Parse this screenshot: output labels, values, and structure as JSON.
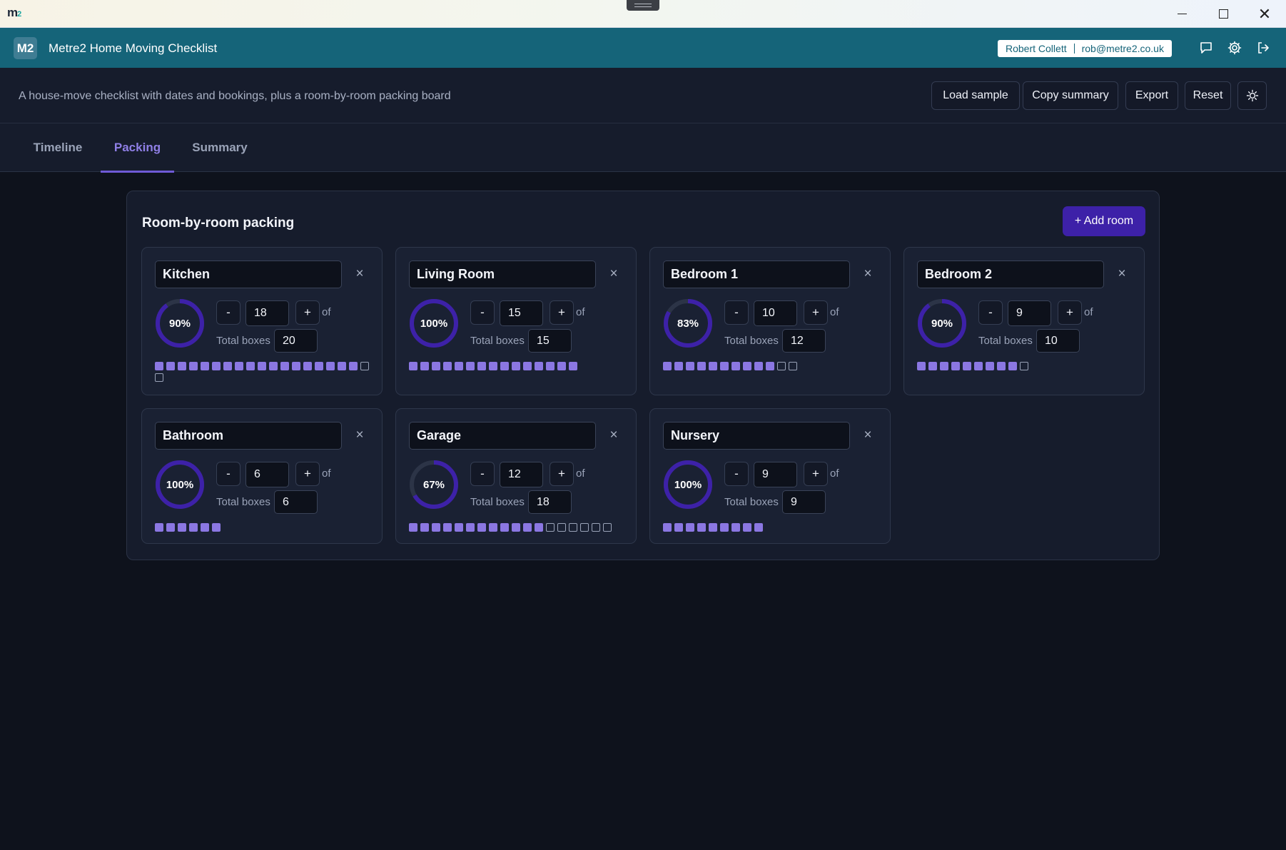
{
  "os": {
    "logo_main": "m",
    "logo_sub": "2",
    "icons": {
      "minimize": "minimize-icon",
      "maximize": "maximize-icon",
      "close": "close-icon"
    }
  },
  "header": {
    "badge": "M2",
    "title": "Metre2 Home Moving Checklist",
    "user_name": "Robert Collett",
    "user_email": "rob@metre2.co.uk",
    "icons": [
      "chat-icon",
      "gear-icon",
      "logout-icon"
    ]
  },
  "subheader": {
    "tagline": "A house-move checklist with dates and bookings, plus a room-by-room packing board",
    "buttons": {
      "load_sample": "Load sample",
      "copy_summary": "Copy summary",
      "export": "Export",
      "reset": "Reset"
    },
    "theme_icon": "sun-icon"
  },
  "tabs": [
    {
      "label": "Timeline",
      "active": false
    },
    {
      "label": "Packing",
      "active": true
    },
    {
      "label": "Summary",
      "active": false
    }
  ],
  "panel": {
    "title": "Room-by-room packing",
    "add_room_label": "+ Add room",
    "minus_label": "-",
    "plus_label": "+",
    "remove_label": "×",
    "of_label": "of",
    "total_label": "Total boxes"
  },
  "rooms": [
    {
      "name": "Kitchen",
      "packed": 18,
      "total": 20,
      "percent": "90%"
    },
    {
      "name": "Living Room",
      "packed": 15,
      "total": 15,
      "percent": "100%"
    },
    {
      "name": "Bedroom 1",
      "packed": 10,
      "total": 12,
      "percent": "83%"
    },
    {
      "name": "Bedroom 2",
      "packed": 9,
      "total": 10,
      "percent": "90%"
    },
    {
      "name": "Bathroom",
      "packed": 6,
      "total": 6,
      "percent": "100%"
    },
    {
      "name": "Garage",
      "packed": 12,
      "total": 18,
      "percent": "67%"
    },
    {
      "name": "Nursery",
      "packed": 9,
      "total": 9,
      "percent": "100%"
    }
  ],
  "colors": {
    "header_bg": "#156479",
    "accent": "#3d21a8",
    "ring_fill": "#3d21a8",
    "ring_track": "#2c3447",
    "box_full": "#8b77e2",
    "tab_active": "#8f7fe6"
  }
}
